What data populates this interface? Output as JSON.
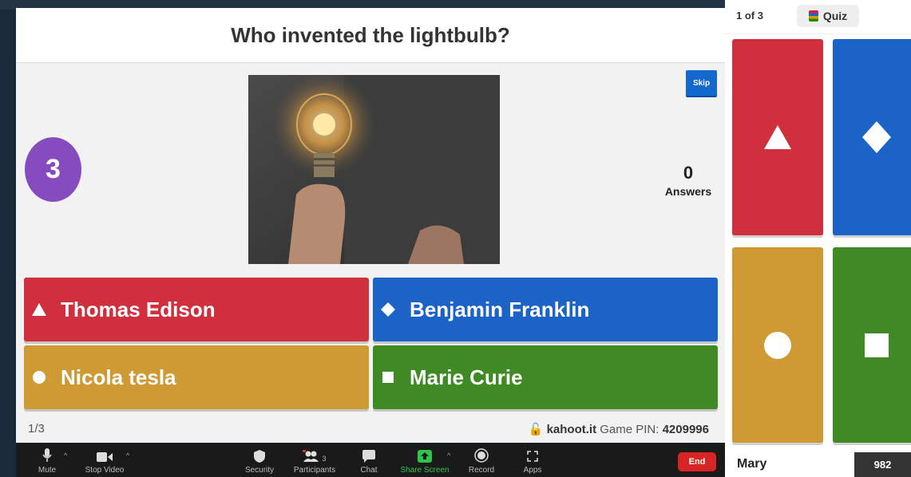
{
  "question": "Who invented the lightbulb?",
  "timer": "3",
  "skip_label": "Skip",
  "answers_count": "0",
  "answers_label": "Answers",
  "options": [
    {
      "label": "Thomas Edison",
      "shape": "triangle-icon",
      "color": "#d0303d"
    },
    {
      "label": "Benjamin Franklin",
      "shape": "diamond-icon",
      "color": "#1b63c7"
    },
    {
      "label": "Nicola tesla",
      "shape": "circle-icon",
      "color": "#cf9a33"
    },
    {
      "label": "Marie Curie",
      "shape": "square-icon",
      "color": "#3f8a25"
    }
  ],
  "footer": {
    "progress": "1/3",
    "site": "kahoot.it",
    "pin_label": "Game PIN:",
    "pin": "4209996"
  },
  "toolbar": {
    "mute": "Mute",
    "stop_video": "Stop Video",
    "security": "Security",
    "participants": "Participants",
    "participants_count": "3",
    "chat": "Chat",
    "share_screen": "Share Screen",
    "record": "Record",
    "apps": "Apps",
    "end": "End"
  },
  "player_panel": {
    "counter": "1 of 3",
    "mode": "Quiz",
    "player_name": "Mary",
    "score": "982"
  },
  "colors": {
    "timer": "#864cbf",
    "skip": "#1368ce",
    "share_screen": "#2ec44a",
    "end": "#d72424"
  }
}
